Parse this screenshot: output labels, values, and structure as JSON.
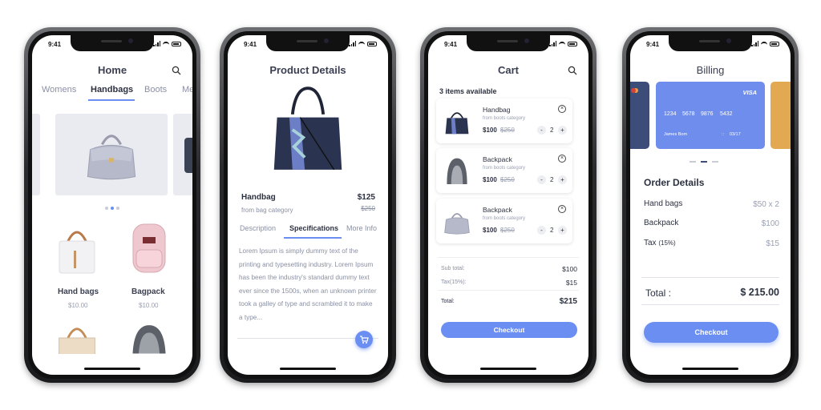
{
  "status": {
    "time": "9:41"
  },
  "home": {
    "title": "Home",
    "tabs": [
      "Womens",
      "Handbags",
      "Boots",
      "Me"
    ],
    "products": [
      {
        "name": "Hand bags",
        "price": "$10.00"
      },
      {
        "name": "Bagpack",
        "price": "$10.00"
      }
    ]
  },
  "details": {
    "title": "Product Details",
    "name": "Handbag",
    "category": "from bag category",
    "price": "$125",
    "old_price": "$250",
    "tabs": [
      "Description",
      "Specifications",
      "More Info"
    ],
    "description": "Lorem Ipsum is simply dummy text of the printing and typesetting industry. Lorem Ipsum has been the industry's standard dummy text ever since the 1500s, when an unknown printer took a galley of type and scrambled it to make a type..."
  },
  "cart": {
    "title": "Cart",
    "items_available": "3 items available",
    "items": [
      {
        "name": "Handbag",
        "category": "from boots category",
        "price": "$100",
        "old_price": "$250",
        "qty": "2"
      },
      {
        "name": "Backpack",
        "category": "from boots category",
        "price": "$100",
        "old_price": "$250",
        "qty": "2"
      },
      {
        "name": "Backpack",
        "category": "from boots category",
        "price": "$100",
        "old_price": "$250",
        "qty": "2"
      }
    ],
    "subtotal_label": "Sub total:",
    "subtotal": "$100",
    "tax_label": "Tax(15%):",
    "tax": "$15",
    "total_label": "Total:",
    "total": "$215",
    "checkout": "Checkout"
  },
  "billing": {
    "title": "Billing",
    "card": {
      "brand": "VISA",
      "number": [
        "1234",
        "5678",
        "9876",
        "5432"
      ],
      "holder": "James Bom",
      "expiry_prefix": "::",
      "expiry": "03/17"
    },
    "order_title": "Order Details",
    "lines": [
      {
        "label": "Hand bags",
        "value": "$50 x 2"
      },
      {
        "label": "Backpack",
        "value": "$100"
      },
      {
        "label": "Tax",
        "label_suffix": "(15%)",
        "value": "$15"
      }
    ],
    "total_label": "Total :",
    "total": "$ 215.00",
    "checkout": "Checkout"
  },
  "colors": {
    "accent": "#6b8ef2",
    "card_blue": "#6e8ded",
    "card_navy": "#3c4d7a",
    "card_gold": "#e2a852"
  }
}
